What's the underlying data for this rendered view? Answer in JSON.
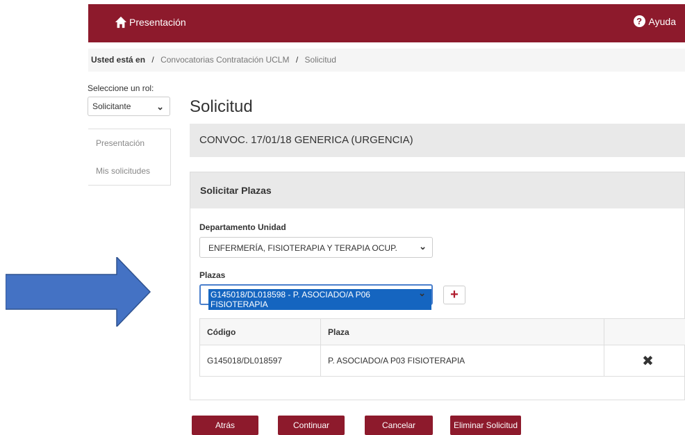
{
  "header": {
    "brand_label": "Presentación",
    "help_label": "Ayuda"
  },
  "breadcrumb": {
    "here_label": "Usted está en",
    "items": [
      "Convocatorias Contratación UCLM",
      "Solicitud"
    ]
  },
  "role": {
    "label": "Seleccione un rol:",
    "selected": "Solicitante"
  },
  "sidebar": {
    "items": [
      {
        "label": "Presentación"
      },
      {
        "label": "Mis solicitudes"
      }
    ]
  },
  "page": {
    "title": "Solicitud",
    "convocatoria": "CONVOC. 17/01/18 GENERICA (URGENCIA)"
  },
  "panel": {
    "title": "Solicitar Plazas",
    "departamento": {
      "label": "Departamento Unidad",
      "selected": "ENFERMERÍA, FISIOTERAPIA Y TERAPIA OCUP."
    },
    "plazas": {
      "label": "Plazas",
      "selected": "G145018/DL018598 - P. ASOCIADO/A P06 FISIOTERAPIA"
    },
    "add_button": "+",
    "table": {
      "headers": [
        "Código",
        "Plaza",
        ""
      ],
      "rows": [
        {
          "codigo": "G145018/DL018597",
          "plaza": "P. ASOCIADO/A P03 FISIOTERAPIA",
          "action": "✖"
        }
      ]
    }
  },
  "buttons": {
    "atras": "Atrás",
    "continuar": "Continuar",
    "cancelar": "Cancelar",
    "eliminar": "Eliminar Solicitud"
  },
  "colors": {
    "brand": "#8d1a2c",
    "arrow": "#4472c4",
    "selection": "#1565c0"
  },
  "icons": {
    "home": "home-icon",
    "help": "help-circle-icon",
    "remove": "remove-x-icon",
    "annotation": "arrow-right-icon"
  }
}
